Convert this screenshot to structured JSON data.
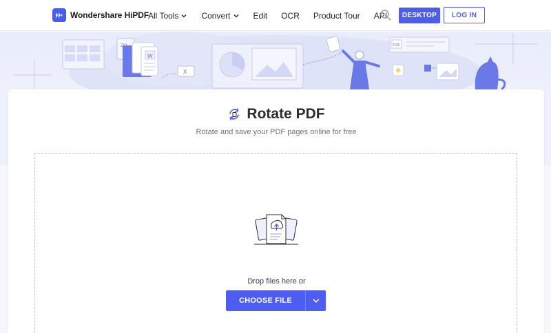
{
  "header": {
    "logo_text": "Wondershare HiPDF",
    "nav": [
      {
        "label": "All Tools",
        "has_dropdown": true
      },
      {
        "label": "Convert",
        "has_dropdown": true
      },
      {
        "label": "Edit",
        "has_dropdown": false
      },
      {
        "label": "OCR",
        "has_dropdown": false
      },
      {
        "label": "Product Tour",
        "has_dropdown": false
      },
      {
        "label": "API",
        "has_dropdown": false
      }
    ],
    "desktop_label": "DESKTOP",
    "login_label": "LOG IN",
    "search_icon": "search-icon"
  },
  "banner": {
    "zip_label": "ZIP",
    "word_label": "W",
    "excel_label": "X",
    "pdf_label": "PDF"
  },
  "main": {
    "title": "Rotate PDF",
    "subtitle": "Rotate and save your PDF pages online for free",
    "drop_text": "Drop files here or",
    "choose_label": "CHOOSE FILE"
  },
  "colors": {
    "accent": "#4d5df0",
    "banner_bg": "#e9ecfb",
    "text": "#2b2b33"
  }
}
